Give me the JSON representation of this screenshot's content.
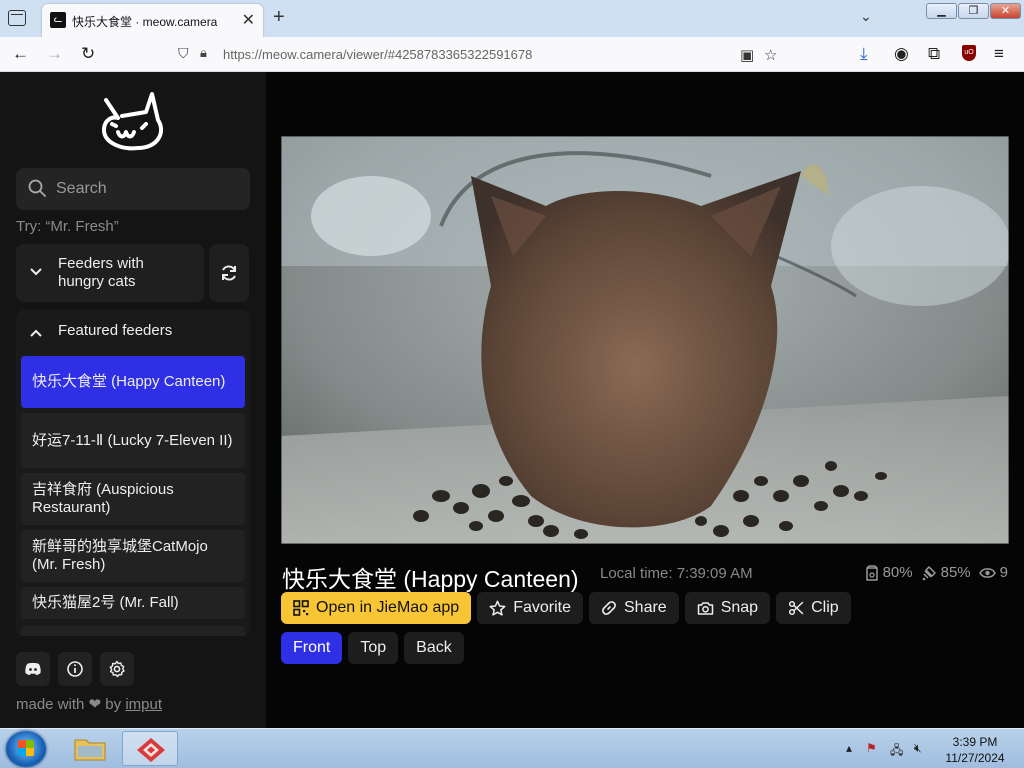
{
  "browser": {
    "tab_title": "快乐大食堂 · meow.camera",
    "tab_favicon": "cat-face",
    "url_host": "https://meow.camera",
    "url_path": "/viewer/#4258783365322591678",
    "window_controls": [
      "minimize",
      "restore",
      "close"
    ]
  },
  "sidebar": {
    "search_placeholder": "Search",
    "try_hint": "Try: “Mr. Fresh”",
    "group_hungry": "Feeders with hungry cats",
    "group_featured": "Featured feeders",
    "feeders": [
      {
        "label": "快乐大食堂 (Happy Canteen)",
        "active": true
      },
      {
        "label": "好运7-11-Ⅱ (Lucky 7-Eleven II)",
        "active": false
      },
      {
        "label": "吉祥食府 (Auspicious Restaurant)",
        "active": false
      },
      {
        "label": "新鲜哥的独享城堡CatMojo (Mr. Fresh)",
        "active": false
      },
      {
        "label": "快乐猫屋2号 (Mr. Fall)",
        "active": false
      }
    ],
    "footer_icons": [
      "discord-icon",
      "info-icon",
      "settings-icon"
    ],
    "made_with": "made with",
    "made_by": "by",
    "author": "imput"
  },
  "viewer": {
    "title": "快乐大食堂 (Happy Canteen)",
    "local_time": "Local time: 7:39:09 AM",
    "food_level": "80%",
    "signal_level": "85%",
    "viewers": "9",
    "actions": {
      "open_app": "Open in JieMao app",
      "favorite": "Favorite",
      "share": "Share",
      "snap": "Snap",
      "clip": "Clip"
    },
    "views": {
      "front": "Front",
      "top": "Top",
      "back": "Back",
      "selected": "Front"
    }
  },
  "taskbar": {
    "time": "3:39 PM",
    "date": "11/27/2024"
  },
  "colors": {
    "accent_blue": "#2f2fe6",
    "accent_yellow": "#f8c534",
    "sidebar_bg": "#141414"
  }
}
